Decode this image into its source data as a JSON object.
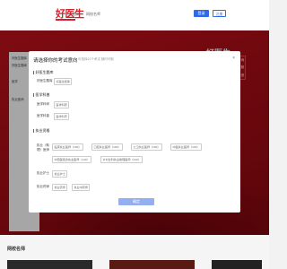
{
  "header": {
    "logo": "好医生",
    "nav": [
      "首页",
      "网校名师"
    ],
    "login": "登录",
    "register": "注册"
  },
  "hero": {
    "logo": "好医生",
    "side_items": [
      "在线咨询",
      "在线客服",
      "意见反馈"
    ],
    "left_panel": [
      "好医生题库",
      "好医生题库",
      "医学",
      "执业医师",
      "",
      "",
      "",
      "",
      "",
      "",
      ""
    ]
  },
  "dialog": {
    "title": "请选择你的考试意向",
    "subtitle": "可选择10个考试 随时可取",
    "close": "×",
    "sections": [
      {
        "title": "好医生题库",
        "rows": [
          {
            "label": "好医生题库",
            "tags": [
              "好医生题库"
            ]
          }
        ]
      },
      {
        "title": "医学科普",
        "rows": [
          {
            "label": "医学科研",
            "tags": [
              "医学科研"
            ]
          },
          {
            "label": "医学科普",
            "tags": [
              "医学科普"
            ]
          }
        ]
      },
      {
        "title": "执业资格",
        "rows": [
          {
            "label": "执业（助理）医师",
            "tags": [
              "临床执业医师（100）",
              "口腔执业医师（100）",
              "公卫执业医师（100）",
              "中医执业医师（140）",
              "中西医结合执业医师（140）",
              "乡村全科执业助理医师（240）"
            ]
          },
          {
            "label": "执业护士",
            "tags": [
              "执业护士"
            ]
          },
          {
            "label": "执业药师",
            "tags": [
              "执业药师",
              "执业中药师"
            ]
          }
        ]
      }
    ],
    "confirm": "确定"
  },
  "bottom": {
    "title": "网校名师"
  }
}
